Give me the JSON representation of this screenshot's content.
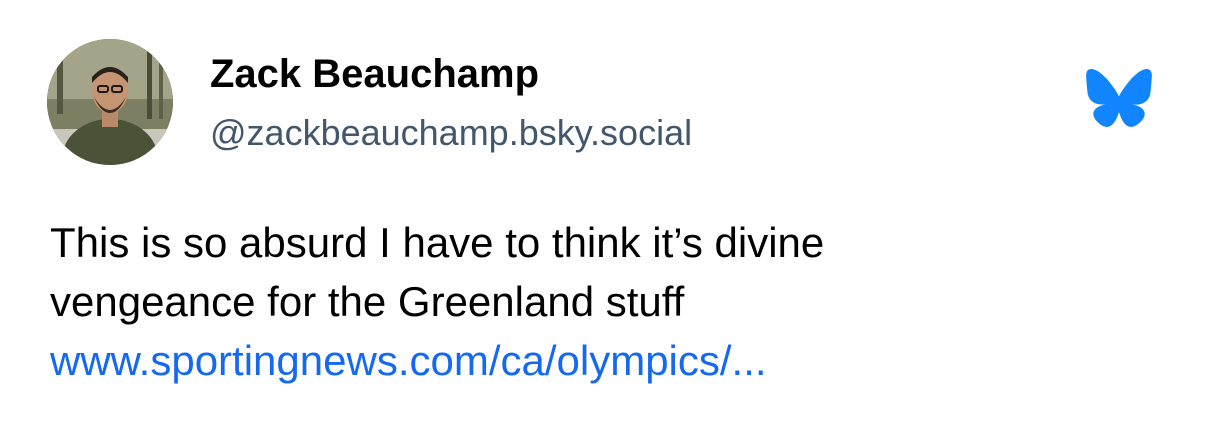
{
  "author": {
    "display_name": "Zack Beauchamp",
    "handle": "@zackbeauchamp.bsky.social",
    "avatar_icon": "user-photo-avatar"
  },
  "brand": {
    "logo_icon": "bluesky-butterfly-icon",
    "color": "#1185fe"
  },
  "post": {
    "text_line1": "This is so absurd I have to think it’s divine",
    "text_line2": "vengeance for the Greenland stuff",
    "link_text": "www.sportingnews.com/ca/olympics/...",
    "link_color": "#1469f0"
  }
}
